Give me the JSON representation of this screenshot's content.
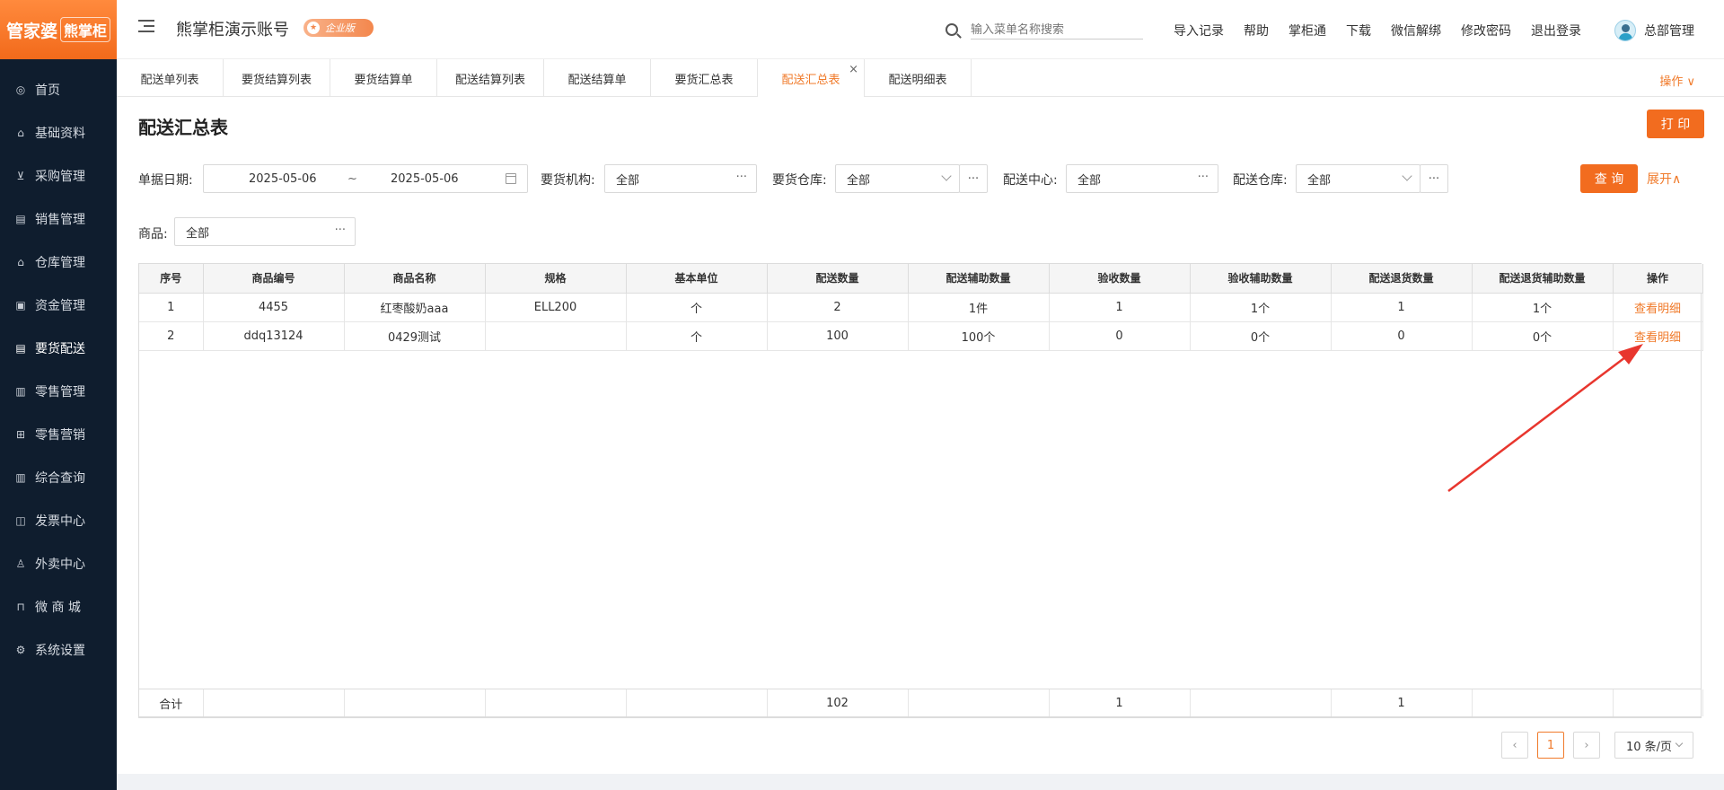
{
  "logo": {
    "part1": "管家婆",
    "part2": "熊掌柜"
  },
  "sidebar": {
    "items": [
      {
        "label": "首页",
        "icon": "globe-icon",
        "glyph": "◎"
      },
      {
        "label": "基础资料",
        "icon": "home-icon",
        "glyph": "⌂"
      },
      {
        "label": "采购管理",
        "icon": "cart-icon",
        "glyph": "⊻"
      },
      {
        "label": "销售管理",
        "icon": "sales-icon",
        "glyph": "▤"
      },
      {
        "label": "仓库管理",
        "icon": "warehouse-icon",
        "glyph": "⌂"
      },
      {
        "label": "资金管理",
        "icon": "wallet-icon",
        "glyph": "▣"
      },
      {
        "label": "要货配送",
        "icon": "delivery-icon",
        "glyph": "▤"
      },
      {
        "label": "零售管理",
        "icon": "retail-icon",
        "glyph": "▥"
      },
      {
        "label": "零售营销",
        "icon": "gift-icon",
        "glyph": "⊞"
      },
      {
        "label": "综合查询",
        "icon": "chart-icon",
        "glyph": "▥"
      },
      {
        "label": "发票中心",
        "icon": "invoice-icon",
        "glyph": "◫"
      },
      {
        "label": "外卖中心",
        "icon": "takeout-icon",
        "glyph": "♙"
      },
      {
        "label": "微 商 城",
        "icon": "shop-icon",
        "glyph": "⊓"
      },
      {
        "label": "系统设置",
        "icon": "gear-icon",
        "glyph": "⚙"
      }
    ],
    "active_index": 6
  },
  "header": {
    "account_title": "熊掌柜演示账号",
    "edition": "企业版",
    "search_placeholder": "输入菜单名称搜索",
    "links": [
      "导入记录",
      "帮助",
      "掌柜通",
      "下载",
      "微信解绑",
      "修改密码",
      "退出登录"
    ],
    "user_name": "总部管理"
  },
  "tabs": [
    {
      "label": "配送单列表"
    },
    {
      "label": "要货结算列表"
    },
    {
      "label": "要货结算单"
    },
    {
      "label": "配送结算列表"
    },
    {
      "label": "配送结算单"
    },
    {
      "label": "要货汇总表"
    },
    {
      "label": "配送汇总表",
      "active": true
    },
    {
      "label": "配送明细表"
    }
  ],
  "tab_close": "×",
  "ops_menu": "操作 ∨",
  "page": {
    "title": "配送汇总表",
    "print_label": "打 印",
    "query_label": "查 询",
    "expand_label": "展开∧"
  },
  "filters": {
    "date_label": "单据日期:",
    "date_from": "2025-05-06",
    "date_sep": "~",
    "date_to": "2025-05-06",
    "org_label": "要货机构:",
    "org_value": "全部",
    "req_wh_label": "要货仓库:",
    "req_wh_value": "全部",
    "center_label": "配送中心:",
    "center_value": "全部",
    "del_wh_label": "配送仓库:",
    "del_wh_value": "全部",
    "goods_label": "商品:",
    "goods_value": "全部",
    "dots": "···"
  },
  "table": {
    "columns": [
      "序号",
      "商品编号",
      "商品名称",
      "规格",
      "基本单位",
      "配送数量",
      "配送辅助数量",
      "验收数量",
      "验收辅助数量",
      "配送退货数量",
      "配送退货辅助数量",
      "操作"
    ],
    "rows": [
      [
        "1",
        "4455",
        "红枣酸奶aaa",
        "ELL200",
        "个",
        "2",
        "1件",
        "1",
        "1个",
        "1",
        "1个",
        "查看明细"
      ],
      [
        "2",
        "ddq13124",
        "0429测试",
        "",
        "个",
        "100",
        "100个",
        "0",
        "0个",
        "0",
        "0个",
        "查看明细"
      ]
    ],
    "summary": [
      "合计",
      "",
      "",
      "",
      "",
      "102",
      "",
      "1",
      "",
      "1",
      "",
      ""
    ]
  },
  "pager": {
    "prev": "‹",
    "current": "1",
    "next": "›",
    "size": "10 条/页"
  },
  "colors": {
    "accent": "#f26c1f",
    "sidebar_bg": "#0f1d2e",
    "annotation_arrow": "#e8362e"
  }
}
